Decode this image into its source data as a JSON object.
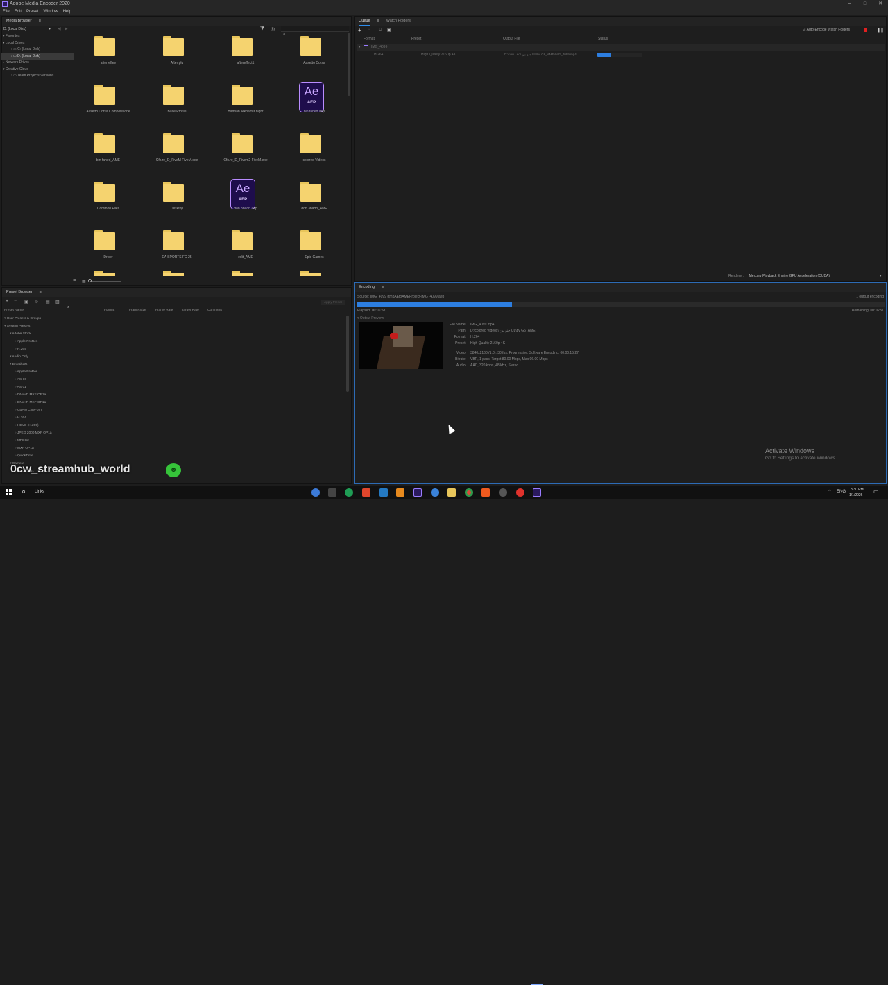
{
  "window": {
    "title": "Adobe Media Encoder 2020",
    "controls": [
      "–",
      "□",
      "✕"
    ]
  },
  "menu": [
    "File",
    "Edit",
    "Preset",
    "Window",
    "Help"
  ],
  "media_browser": {
    "title": "Media Browser",
    "location": "D: (Local Disk)",
    "tree": [
      {
        "label": "Favorites",
        "level": 0
      },
      {
        "label": "Local Drives",
        "level": 0
      },
      {
        "label": "C: (Local Disk)",
        "level": 1
      },
      {
        "label": "D: (Local Disk)",
        "level": 1,
        "selected": true
      },
      {
        "label": "Network Drives",
        "level": 0
      },
      {
        "label": "Creative Cloud",
        "level": 0
      },
      {
        "label": "Team Projects Versions",
        "level": 1
      }
    ],
    "items": [
      {
        "label": "after effee",
        "type": "folder"
      },
      {
        "label": "After plu",
        "type": "folder"
      },
      {
        "label": "aftereffect1",
        "type": "folder"
      },
      {
        "label": "Assetto Corsa",
        "type": "folder"
      },
      {
        "label": "Assetto Corsa Competizione",
        "type": "folder"
      },
      {
        "label": "Base Profile",
        "type": "folder"
      },
      {
        "label": "Batman Arkham Knight",
        "type": "folder"
      },
      {
        "label": "bin fahed.aep",
        "type": "aep"
      },
      {
        "label": "bin fahed_AME",
        "type": "folder"
      },
      {
        "label": "Cfx.re_D_FiveM FiveM.exe",
        "type": "folder"
      },
      {
        "label": "Cfx.re_D_Fivem2 FiveM.exe",
        "type": "folder"
      },
      {
        "label": "colored Videos",
        "type": "folder"
      },
      {
        "label": "Common Files",
        "type": "folder"
      },
      {
        "label": "Desktop",
        "type": "folder"
      },
      {
        "label": "don 3badh.aep",
        "type": "aep"
      },
      {
        "label": "don 3badh_AME",
        "type": "folder"
      },
      {
        "label": "Driver",
        "type": "folder"
      },
      {
        "label": "EA SPORTS FC 25",
        "type": "folder"
      },
      {
        "label": "edit_AME",
        "type": "folder"
      },
      {
        "label": "Epic Games",
        "type": "folder"
      }
    ],
    "aep_icon_text": "Ae",
    "aep_icon_sub": "AEP"
  },
  "preset_browser": {
    "title": "Preset Browser",
    "apply_label": "Apply Preset",
    "columns": [
      "Preset Name",
      "Format",
      "Frame Size",
      "Frame Rate",
      "Target Rate",
      "Comment"
    ],
    "rows": [
      {
        "label": "User Presets & Groups",
        "level": 0
      },
      {
        "label": "System Presets",
        "level": 0
      },
      {
        "label": "Adobe Stock",
        "level": 1
      },
      {
        "label": "Apple ProRes",
        "level": 2
      },
      {
        "label": "H.264",
        "level": 2
      },
      {
        "label": "Audio Only",
        "level": 1
      },
      {
        "label": "Broadcast",
        "level": 1
      },
      {
        "label": "Apple ProRes",
        "level": 2
      },
      {
        "label": "AS-10",
        "level": 2
      },
      {
        "label": "AS-11",
        "level": 2
      },
      {
        "label": "DNxHD MXF OP1a",
        "level": 2
      },
      {
        "label": "DNxHR MXF OP1a",
        "level": 2
      },
      {
        "label": "GoPro CineForm",
        "level": 2
      },
      {
        "label": "H.264",
        "level": 2
      },
      {
        "label": "HEVC (H.265)",
        "level": 2
      },
      {
        "label": "JPEG 2000 MXF OP1a",
        "level": 2
      },
      {
        "label": "MPEG2",
        "level": 2
      },
      {
        "label": "MXF OP1a",
        "level": 2
      },
      {
        "label": "QuickTime",
        "level": 2
      },
      {
        "label": "Camera",
        "level": 1
      },
      {
        "label": "AVC-Long..",
        "level": 2
      }
    ]
  },
  "queue": {
    "tabs": [
      "Queue",
      "Watch Folders"
    ],
    "auto_encode_label": "Auto-Encode Watch Folders",
    "columns": [
      "Format",
      "Preset",
      "Output File",
      "Status"
    ],
    "job": {
      "name": "IMG_4099",
      "format": "H.264",
      "preset": "High Quality 2160p 4K",
      "output_file": "D:\\colo...ed\\ جنو بین UL\\bv G6_AME\\IMG_4099.mp4",
      "progress": 0.3
    },
    "renderer_label": "Renderer:",
    "renderer_value": "Mercury Playback Engine GPU Acceleration (CUDA)"
  },
  "encoding": {
    "title": "Encoding",
    "source": "Source: IMG_4099 (tmpAEtoAMEProject-IMG_4099.aep)",
    "output_count": "1 output encoding",
    "elapsed": "Elapsed: 00:06:58",
    "remaining": "Remaining: 00:16:51",
    "progress": 0.295,
    "output_preview_label": "Output Preview",
    "details": [
      {
        "key": "File Name:",
        "value": "IMG_4099.mp4"
      },
      {
        "key": "Path:",
        "value": "D:\\colored Videos\\ جنو بین UL\\bv G6_AME\\"
      },
      {
        "key": "Format:",
        "value": "H.264"
      },
      {
        "key": "Preset:",
        "value": "High Quality 2160p 4K"
      },
      {
        "key": "Video:",
        "value": "3840x2160 (1.0), 30 fps, Progressive, Software Encoding, 00:00:15:27"
      },
      {
        "key": "Bitrate:",
        "value": "VBR, 1 pass, Target 80.00 Mbps, Max 96.00 Mbps"
      },
      {
        "key": "Audio:",
        "value": "AAC, 320 kbps, 48 kHz, Stereo"
      }
    ]
  },
  "watermark": {
    "line1": "Activate Windows",
    "line2": "Go to Settings to activate Windows."
  },
  "overlay_text": "0cw_streamhub_world",
  "taskbar": {
    "search_label": "Links",
    "language": "ENG",
    "time": "8:30 PM",
    "date": "1/1/2026"
  },
  "colors": {
    "accent": "#2d7ee0",
    "folder": "#f5d36f",
    "ae_purple": "#b98cff",
    "stop_red": "#e02020"
  }
}
